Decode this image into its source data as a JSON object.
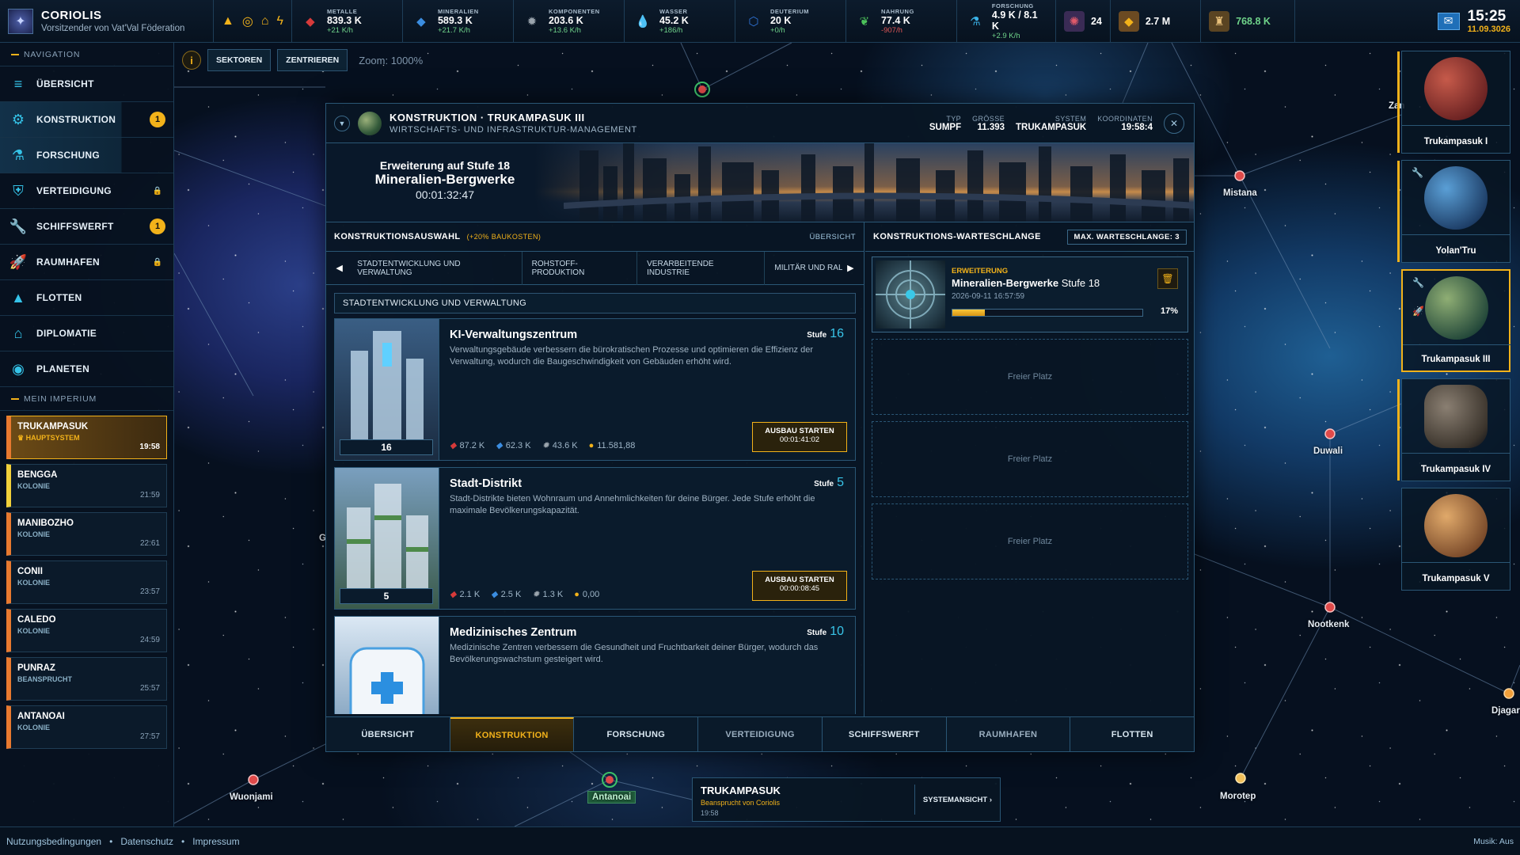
{
  "app": {
    "title": "CORIOLIS",
    "subtitle": "Vorsitzender von Vat'Val Föderation"
  },
  "resources": [
    {
      "icon": "metal-icon",
      "label": "METALLE",
      "value": "839.3 K",
      "rate": "+21 K/h",
      "color": "#d63a3a"
    },
    {
      "icon": "minerals-icon",
      "label": "MINERALIEN",
      "value": "589.3 K",
      "rate": "+21.7 K/h",
      "color": "#3b8de0"
    },
    {
      "icon": "components-icon",
      "label": "KOMPONENTEN",
      "value": "203.6 K",
      "rate": "+13.6 K/h",
      "color": "#9aa4ad"
    },
    {
      "icon": "water-icon",
      "label": "WASSER",
      "value": "45.2 K",
      "rate": "+186/h",
      "color": "#3aa7e8"
    },
    {
      "icon": "deuterium-icon",
      "label": "DEUTERIUM",
      "value": "20 K",
      "rate": "+0/h",
      "color": "#2f73d6"
    },
    {
      "icon": "food-icon",
      "label": "NAHRUNG",
      "value": "77.4 K",
      "rate": "-907/h",
      "color": "#4cc25a",
      "negative": true
    },
    {
      "icon": "research-icon",
      "label": "FORSCHUNG",
      "value": "4.9 K / 8.1 K",
      "rate": "+2.9 K/h",
      "color": "#3ab3e8"
    }
  ],
  "extras": [
    {
      "icon": "population-icon",
      "value": "24"
    },
    {
      "icon": "credits-icon",
      "value": "2.7 M"
    },
    {
      "icon": "influence-icon",
      "value": "768.8 K"
    }
  ],
  "clock": {
    "time": "15:25",
    "date": "11.09.3026"
  },
  "nav": {
    "title": "NAVIGATION",
    "items": [
      {
        "label": "ÜBERSICHT",
        "icon": "overview-icon",
        "active": false
      },
      {
        "label": "KONSTRUKTION",
        "icon": "gear-icon",
        "active": true,
        "badge": "1"
      },
      {
        "label": "FORSCHUNG",
        "icon": "flask-icon",
        "active": true
      },
      {
        "label": "VERTEIDIGUNG",
        "icon": "defense-icon",
        "locked": true
      },
      {
        "label": "SCHIFFSWERFT",
        "icon": "wrench-icon",
        "badge": "1"
      },
      {
        "label": "RAUMHAFEN",
        "icon": "rocket-icon",
        "locked": true
      },
      {
        "label": "FLOTTEN",
        "icon": "fleet-icon"
      },
      {
        "label": "DIPLOMATIE",
        "icon": "diplomacy-icon"
      },
      {
        "label": "PLANETEN",
        "icon": "planet-icon"
      }
    ]
  },
  "empire": {
    "title": "MEIN IMPERIUM",
    "colonies": [
      {
        "name": "TRUKAMPASUK",
        "type": "HAUPTSYSTEM",
        "time": "19:58",
        "selected": true
      },
      {
        "name": "BENGGA",
        "type": "KOLONIE",
        "time": "21:59"
      },
      {
        "name": "MANIBOZHO",
        "type": "KOLONIE",
        "time": "22:61"
      },
      {
        "name": "CONII",
        "type": "KOLONIE",
        "time": "23:57"
      },
      {
        "name": "CALEDO",
        "type": "KOLONIE",
        "time": "24:59"
      },
      {
        "name": "PUNRAZ",
        "type": "BEANSPRUCHT",
        "time": "25:57"
      },
      {
        "name": "ANTANOAI",
        "type": "KOLONIE",
        "time": "27:57"
      }
    ]
  },
  "mapctl": {
    "sectors": "SEKTOREN",
    "center": "ZENTRIEREN",
    "zoom": "Zoom: 1000%"
  },
  "systems": {
    "mistana": "Mistana",
    "duwali": "Duwali",
    "nootkenk": "Nootkenk",
    "djagar": "Djagar",
    "morotep": "Morotep",
    "wuonjami": "Wuonjami",
    "antanoai": "Antanoai",
    "zan": "Zan",
    "g": "G"
  },
  "dialog": {
    "title": "KONSTRUKTION · TRUKAMPASUK III",
    "subtitle": "WIRTSCHAFTS- UND INFRASTRUKTUR-MANAGEMENT",
    "stats": [
      {
        "label": "TYP",
        "value": "SUMPF"
      },
      {
        "label": "GRÖSSE",
        "value": "11.393"
      },
      {
        "label": "SYSTEM",
        "value": "TRUKAMPASUK"
      },
      {
        "label": "KOORDINATEN",
        "value": "19:58:4"
      }
    ],
    "banner": {
      "line1": "Erweiterung auf Stufe 18",
      "line2": "Mineralien-Bergwerke",
      "timer": "00:01:32:47"
    },
    "selection": {
      "title": "KONSTRUKTIONSAUSWAHL",
      "note": "(+20% BAUKOSTEN)",
      "overview": "ÜBERSICHT"
    },
    "categories": [
      "STADTENTWICKLUNG UND VERWALTUNG",
      "ROHSTOFF-PRODUKTION",
      "VERARBEITENDE INDUSTRIE",
      "MILITÄR UND RAL"
    ],
    "section": "STADTENTWICKLUNG UND VERWALTUNG",
    "buildings": [
      {
        "name": "KI-Verwaltungszentrum",
        "stufe_label": "Stufe",
        "level": "16",
        "desc": "Verwaltungsgebäude verbessern die bürokratischen Prozesse und optimieren die Effizienz der Verwaltung, wodurch die Baugeschwindigkeit von Gebäuden erhöht wird.",
        "costs": [
          "87.2 K",
          "62.3 K",
          "43.6 K",
          "11.581,88"
        ],
        "build": "AUSBAU STARTEN",
        "time": "00:01:41:02"
      },
      {
        "name": "Stadt-Distrikt",
        "stufe_label": "Stufe",
        "level": "5",
        "desc": "Stadt-Distrikte bieten Wohnraum und Annehmlichkeiten für deine Bürger. Jede Stufe erhöht die maximale Bevölkerungskapazität.",
        "costs": [
          "2.1 K",
          "2.5 K",
          "1.3 K",
          "0,00"
        ],
        "build": "AUSBAU STARTEN",
        "time": "00:00:08:45"
      },
      {
        "name": "Medizinisches Zentrum",
        "stufe_label": "Stufe",
        "level": "10",
        "desc": "Medizinische Zentren verbessern die Gesundheit und Fruchtbarkeit deiner Bürger, wodurch das Bevölkerungswachstum gesteigert wird."
      }
    ],
    "queue": {
      "title": "KONSTRUKTIONS-WARTESCHLANGE",
      "max": "MAX. WARTESCHLANGE: 3",
      "item": {
        "type": "ERWEITERUNG",
        "name": "Mineralien-Bergwerke",
        "stufe": "Stufe 18",
        "date": "2026-09-11 16:57:59",
        "progress": 17,
        "progress_label": "17%"
      },
      "free": [
        "Freier Platz",
        "Freier Platz",
        "Freier Platz"
      ]
    },
    "tabs": [
      "ÜBERSICHT",
      "KONSTRUKTION",
      "FORSCHUNG",
      "VERTEIDIGUNG",
      "SCHIFFSWERFT",
      "RAUMHAFEN",
      "FLOTTEN"
    ]
  },
  "planets": [
    {
      "name": "Trukampasuk I",
      "colors": [
        "#c65a4a",
        "#6a2222"
      ]
    },
    {
      "name": "Yolan'Tru",
      "colors": [
        "#5a9fd6",
        "#1d3d66"
      ]
    },
    {
      "name": "Trukampasuk III",
      "colors": [
        "#8fae74",
        "#23483a"
      ]
    },
    {
      "name": "Trukampasuk IV",
      "colors": [
        "#8a7f72",
        "#3b342c"
      ]
    },
    {
      "name": "Trukampasuk V",
      "colors": [
        "#e0a96a",
        "#7a4a2a"
      ]
    }
  ],
  "systembox": {
    "name": "TRUKAMPASUK",
    "owner": "Beansprucht von Coriolis",
    "time": "19:58",
    "view": "SYSTEMANSICHT ›"
  },
  "footer": {
    "terms": "Nutzungsbedingungen",
    "privacy": "Datenschutz",
    "imprint": "Impressum",
    "music": "Musik: Aus"
  }
}
